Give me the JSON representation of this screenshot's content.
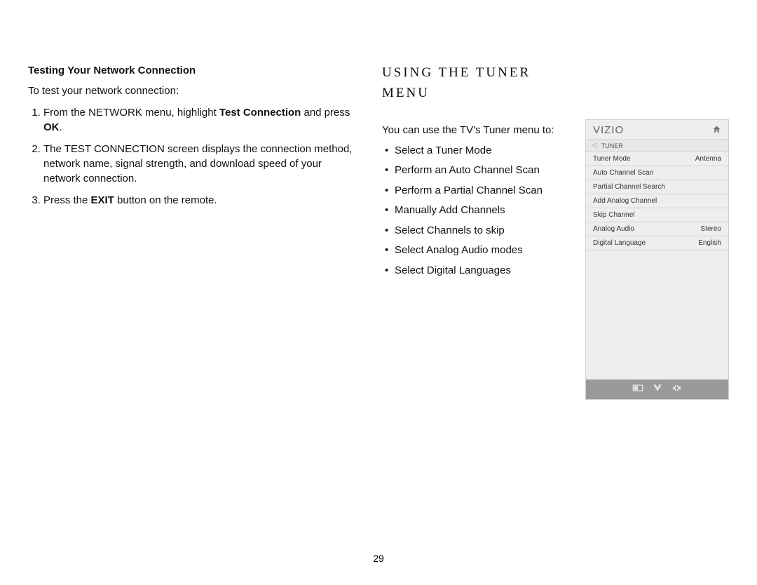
{
  "page_number": "29",
  "left": {
    "heading": "Testing Your Network Connection",
    "intro": "To test your network connection:",
    "steps": {
      "s1_pre": "From the NETWORK menu, highlight ",
      "s1_bold1": "Test Connection",
      "s1_mid": " and press ",
      "s1_bold2": "OK",
      "s1_end": ".",
      "s2": "The TEST CONNECTION screen displays the connection method, network name, signal strength, and download speed of your network connection.",
      "s3_pre": "Press the ",
      "s3_bold": "EXIT",
      "s3_end": " button on the remote."
    }
  },
  "right": {
    "heading": "USING THE TUNER MENU",
    "intro": "You can use the TV's Tuner menu to:",
    "bullets": [
      "Select a Tuner Mode",
      "Perform an Auto Channel Scan",
      "Perform a Partial Channel Scan",
      "Manually Add Channels",
      "Select Channels to skip",
      "Select Analog Audio modes",
      "Select Digital Languages"
    ]
  },
  "device": {
    "brand": "VIZIO",
    "crumb": "TUNER",
    "rows": [
      {
        "label": "Tuner Mode",
        "value": "Antenna"
      },
      {
        "label": "Auto Channel Scan",
        "value": ""
      },
      {
        "label": "Partial Channel Search",
        "value": ""
      },
      {
        "label": "Add Analog Channel",
        "value": ""
      },
      {
        "label": "Skip Channel",
        "value": ""
      },
      {
        "label": "Analog Audio",
        "value": "Stereo"
      },
      {
        "label": "Digital Language",
        "value": "English"
      }
    ],
    "footer": {
      "cc": "▭",
      "v": "❤",
      "gear": "✷"
    }
  }
}
